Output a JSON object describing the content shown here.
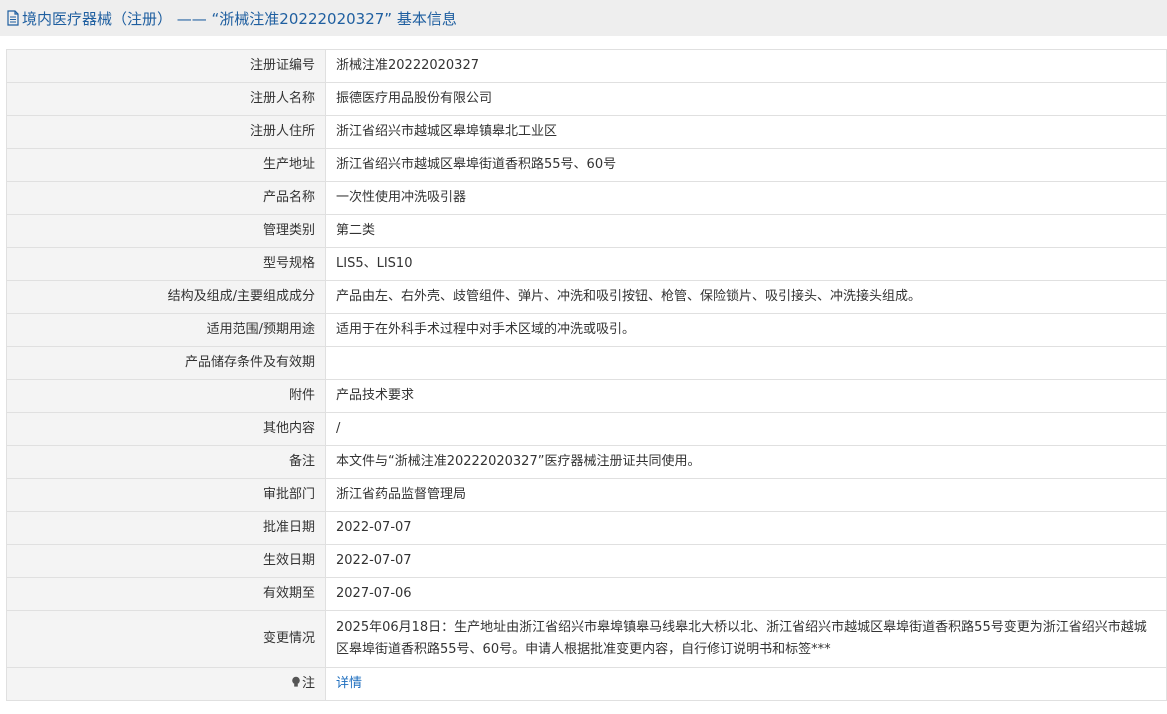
{
  "header": {
    "icon": "document-icon",
    "title": "境内医疗器械（注册） —— “浙械注准20222020327” 基本信息"
  },
  "rows": [
    {
      "label": "注册证编号",
      "value": "浙械注准20222020327"
    },
    {
      "label": "注册人名称",
      "value": "振德医疗用品股份有限公司"
    },
    {
      "label": "注册人住所",
      "value": "浙江省绍兴市越城区皋埠镇皋北工业区"
    },
    {
      "label": "生产地址",
      "value": "浙江省绍兴市越城区皋埠街道香积路55号、60号"
    },
    {
      "label": "产品名称",
      "value": "一次性使用冲洗吸引器"
    },
    {
      "label": "管理类别",
      "value": "第二类"
    },
    {
      "label": "型号规格",
      "value": "LIS5、LIS10"
    },
    {
      "label": "结构及组成/主要组成成分",
      "value": "产品由左、右外壳、歧管组件、弹片、冲洗和吸引按钮、枪管、保险锁片、吸引接头、冲洗接头组成。"
    },
    {
      "label": "适用范围/预期用途",
      "value": "适用于在外科手术过程中对手术区域的冲洗或吸引。"
    },
    {
      "label": "产品储存条件及有效期",
      "value": ""
    },
    {
      "label": "附件",
      "value": "产品技术要求"
    },
    {
      "label": "其他内容",
      "value": "/"
    },
    {
      "label": "备注",
      "value": "本文件与“浙械注准20222020327”医疗器械注册证共同使用。"
    },
    {
      "label": "审批部门",
      "value": "浙江省药品监督管理局"
    },
    {
      "label": "批准日期",
      "value": "2022-07-07"
    },
    {
      "label": "生效日期",
      "value": "2022-07-07"
    },
    {
      "label": "有效期至",
      "value": "2027-07-06"
    },
    {
      "label": "变更情况",
      "value": "2025年06月18日：生产地址由浙江省绍兴市皋埠镇皋马线皋北大桥以北、浙江省绍兴市越城区皋埠街道香积路55号变更为浙江省绍兴市越城区皋埠街道香积路55号、60号。申请人根据批准变更内容，自行修订说明书和标签***"
    }
  ],
  "note_row": {
    "icon": "lightbulb-icon",
    "label": "注",
    "link": "详情"
  }
}
